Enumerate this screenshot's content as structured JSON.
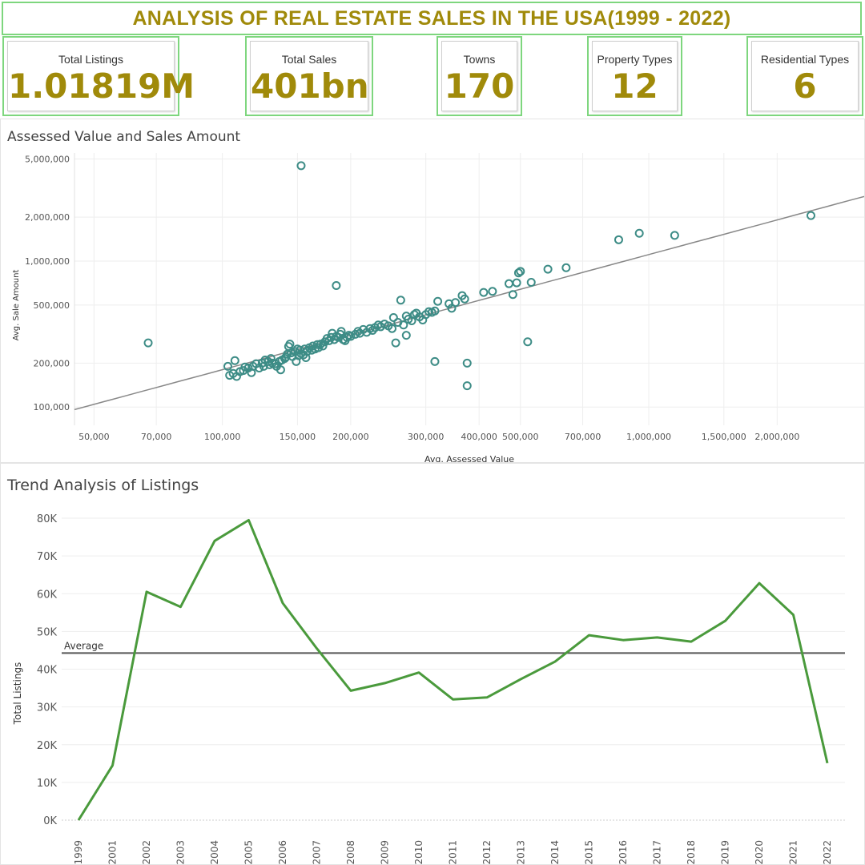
{
  "header": {
    "title": "ANALYSIS OF REAL ESTATE SALES IN THE USA(1999 - 2022)"
  },
  "kpis": [
    {
      "label": "Total Listings",
      "value": "1.01819M"
    },
    {
      "label": "Total Sales",
      "value": "401bn"
    },
    {
      "label": "Towns",
      "value": "170"
    },
    {
      "label": "Property Types",
      "value": "12"
    },
    {
      "label": "Residential Types",
      "value": "6"
    }
  ],
  "colors": {
    "accent": "#a08a0a",
    "border": "#7ed67e",
    "scatter": "#3d8c86",
    "line": "#4a9a3c",
    "trend": "#888888",
    "average": "#555555"
  },
  "chart_data": [
    {
      "type": "scatter",
      "title": "Assessed Value and Sales Amount",
      "xlabel": "Avg. Assessed Value",
      "ylabel": "Avg. Sale Amount",
      "x_scale": "log",
      "y_scale": "log",
      "xlim": [
        45000,
        3200000
      ],
      "ylim": [
        75000,
        5500000
      ],
      "x_ticks": [
        "50,000",
        "70,000",
        "100,000",
        "150,000",
        "200,000",
        "300,000",
        "400,000",
        "500,000",
        "700,000",
        "1,000,000",
        "1,500,000",
        "2,000,000"
      ],
      "y_ticks": [
        "100,000",
        "200,000",
        "500,000",
        "1,000,000",
        "2,000,000",
        "5,000,000"
      ],
      "grid": true,
      "trend_line": "power",
      "points": [
        [
          67000,
          275000
        ],
        [
          153000,
          4500000
        ],
        [
          185000,
          680000
        ],
        [
          375000,
          200000
        ],
        [
          315000,
          205000
        ],
        [
          375000,
          140000
        ],
        [
          520000,
          280000
        ],
        [
          255000,
          275000
        ],
        [
          270000,
          310000
        ],
        [
          103000,
          190000
        ],
        [
          104000,
          165000
        ],
        [
          106000,
          170000
        ],
        [
          107000,
          208000
        ],
        [
          108000,
          162000
        ],
        [
          110000,
          175000
        ],
        [
          112000,
          178000
        ],
        [
          113000,
          188000
        ],
        [
          115000,
          185000
        ],
        [
          117000,
          172000
        ],
        [
          118000,
          190000
        ],
        [
          120000,
          198000
        ],
        [
          122000,
          185000
        ],
        [
          124000,
          200000
        ],
        [
          125000,
          190000
        ],
        [
          126000,
          210000
        ],
        [
          128000,
          205000
        ],
        [
          129000,
          195000
        ],
        [
          130000,
          215000
        ],
        [
          131000,
          200000
        ],
        [
          133000,
          198000
        ],
        [
          134000,
          190000
        ],
        [
          136000,
          205000
        ],
        [
          137000,
          180000
        ],
        [
          138000,
          210000
        ],
        [
          140000,
          215000
        ],
        [
          141000,
          220000
        ],
        [
          142000,
          230000
        ],
        [
          143000,
          260000
        ],
        [
          144000,
          270000
        ],
        [
          145000,
          235000
        ],
        [
          146000,
          222000
        ],
        [
          148000,
          240000
        ],
        [
          149000,
          205000
        ],
        [
          150000,
          250000
        ],
        [
          151000,
          225000
        ],
        [
          152000,
          245000
        ],
        [
          153000,
          232000
        ],
        [
          155000,
          228000
        ],
        [
          156000,
          250000
        ],
        [
          157000,
          218000
        ],
        [
          158000,
          240000
        ],
        [
          160000,
          255000
        ],
        [
          162000,
          245000
        ],
        [
          163000,
          262000
        ],
        [
          165000,
          250000
        ],
        [
          167000,
          268000
        ],
        [
          168000,
          255000
        ],
        [
          170000,
          270000
        ],
        [
          172000,
          262000
        ],
        [
          174000,
          280000
        ],
        [
          176000,
          295000
        ],
        [
          178000,
          285000
        ],
        [
          180000,
          300000
        ],
        [
          181000,
          320000
        ],
        [
          183000,
          290000
        ],
        [
          185000,
          305000
        ],
        [
          187000,
          300000
        ],
        [
          189000,
          315000
        ],
        [
          190000,
          330000
        ],
        [
          192000,
          290000
        ],
        [
          194000,
          285000
        ],
        [
          196000,
          300000
        ],
        [
          198000,
          310000
        ],
        [
          200000,
          305000
        ],
        [
          205000,
          315000
        ],
        [
          208000,
          330000
        ],
        [
          210000,
          320000
        ],
        [
          214000,
          340000
        ],
        [
          218000,
          325000
        ],
        [
          222000,
          345000
        ],
        [
          225000,
          335000
        ],
        [
          228000,
          350000
        ],
        [
          232000,
          365000
        ],
        [
          235000,
          355000
        ],
        [
          240000,
          370000
        ],
        [
          245000,
          360000
        ],
        [
          250000,
          345000
        ],
        [
          252000,
          410000
        ],
        [
          258000,
          380000
        ],
        [
          262000,
          540000
        ],
        [
          266000,
          365000
        ],
        [
          270000,
          420000
        ],
        [
          273000,
          400000
        ],
        [
          278000,
          390000
        ],
        [
          282000,
          430000
        ],
        [
          285000,
          440000
        ],
        [
          290000,
          415000
        ],
        [
          295000,
          395000
        ],
        [
          300000,
          430000
        ],
        [
          305000,
          450000
        ],
        [
          310000,
          445000
        ],
        [
          315000,
          455000
        ],
        [
          320000,
          530000
        ],
        [
          340000,
          510000
        ],
        [
          345000,
          475000
        ],
        [
          352000,
          520000
        ],
        [
          365000,
          580000
        ],
        [
          370000,
          550000
        ],
        [
          410000,
          610000
        ],
        [
          430000,
          620000
        ],
        [
          470000,
          700000
        ],
        [
          480000,
          590000
        ],
        [
          490000,
          710000
        ],
        [
          495000,
          830000
        ],
        [
          500000,
          850000
        ],
        [
          530000,
          715000
        ],
        [
          580000,
          880000
        ],
        [
          640000,
          900000
        ],
        [
          850000,
          1400000
        ],
        [
          950000,
          1550000
        ],
        [
          1150000,
          1500000
        ],
        [
          2400000,
          2050000
        ]
      ]
    },
    {
      "type": "line",
      "title": "Trend Analysis of Listings",
      "xlabel": "",
      "ylabel": "Total Listings",
      "categories": [
        "1999",
        "2001",
        "2002",
        "2003",
        "2004",
        "2005",
        "2006",
        "2007",
        "2008",
        "2009",
        "2010",
        "2011",
        "2012",
        "2013",
        "2014",
        "2015",
        "2016",
        "2017",
        "2018",
        "2019",
        "2020",
        "2021",
        "2022"
      ],
      "values": [
        0,
        14500,
        60500,
        56500,
        74000,
        79500,
        57500,
        45500,
        34300,
        36300,
        39100,
        32000,
        32500,
        37400,
        42000,
        49000,
        47700,
        48400,
        47300,
        52800,
        62800,
        54400,
        15100
      ],
      "ylim": [
        0,
        80000
      ],
      "y_ticks": [
        "0K",
        "10K",
        "20K",
        "30K",
        "40K",
        "50K",
        "60K",
        "70K",
        "80K"
      ],
      "reference_line": {
        "label": "Average",
        "value": 44270
      },
      "grid": true
    }
  ]
}
